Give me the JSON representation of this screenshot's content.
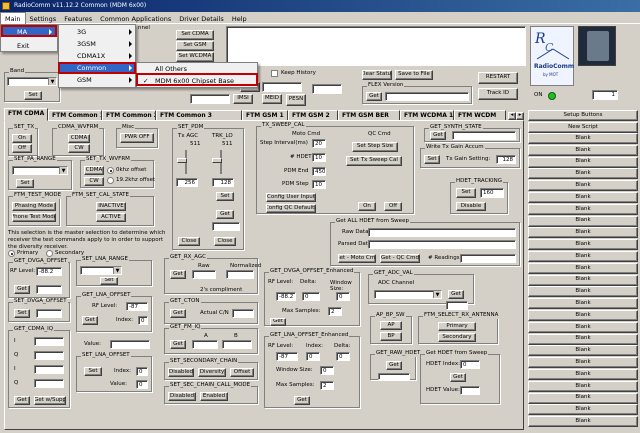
{
  "title": "RadioComm  v11.12.2  Common (MDM 6x00)",
  "menu": [
    "Main",
    "Settings",
    "Features",
    "Common Applications",
    "Driver Details",
    "Help"
  ],
  "main_menu": {
    "ma": "MA",
    "exit": "Exit"
  },
  "ma_submenu": [
    "3G",
    "3GSM",
    "CDMA1X",
    "Common",
    "GSM"
  ],
  "common_submenu": {
    "all_others": "All Others",
    "mdm": "MDM 6x00 Chipset Base"
  },
  "top": {
    "set_cdma": "Set CDMA",
    "set_gsm": "Set GSM",
    "set_wcdma": "Set WCDMA",
    "channel": "nnel",
    "band": "Band",
    "set": "Set",
    "keep_history": "Keep History",
    "clear_status": "Clear Status",
    "save_to_file": "Save to File",
    "esn": "ESN",
    "imsi": "IMSI",
    "meid": "MEID",
    "pesn": "PESN",
    "get": "Get",
    "flex_version": "FLEX Version",
    "restart": "RESTART",
    "track_id": "Track ID",
    "logo_text": "RadioComm",
    "logo_by": "by MOT",
    "on": "ON",
    "spin_val": "1"
  },
  "tabs": [
    "FTM CDMA",
    "FTM Common 1",
    "FTM Common 2",
    "FTM Common 3",
    "FTM GSM 1",
    "FTM GSM 2",
    "FTM GSM BER",
    "FTM WCDMA 1",
    "FTM WCDM"
  ],
  "right": {
    "setup_buttons": "Setup Buttons",
    "new_script": "New Script",
    "blank": "Blank"
  },
  "cdma": {
    "set_tx": "SET_TX",
    "on": "On",
    "off": "Off",
    "cdma_wvfrm": "CDMA_WVFRM",
    "cdma": "CDMA",
    "cw": "CW",
    "misc": "Misc",
    "pwr_off": "PWR OFF",
    "set_pdm": "SET_PDM",
    "tx_agc": "Tx AGC",
    "trk_lo": "TRK_LO",
    "agc_val": "511",
    "trk_val": "511",
    "agc_spin": "256",
    "trk_spin": "128",
    "set": "Set",
    "get": "Get",
    "close": "Close",
    "tx_sweep": "TX_SWEEP_CAL",
    "moto_cmd": "Moto Cmd",
    "qc_cmd": "QC Cmd",
    "step_interval": "Step Interval(ms)",
    "step_interval_val": "20",
    "hdet": "# HDET",
    "hdet_val": "10",
    "pdm_end": "PDM End",
    "pdm_end_val": "450",
    "pdm_step": "PDM Step",
    "pdm_step_val": "10",
    "set_step_size": "Set Step Size",
    "set_tx_sweep_cal": "Set Tx Sweep Cal",
    "config_user_input": "Config User Input",
    "config_qc_defaults": "Config QC Defaults",
    "get_synth": "GET_SYNTH_STATE",
    "write_tx_gain": "Write Tx Gain Accum",
    "tx_gain_setting": "Tx Gain Setting:",
    "tx_gain_val": "128",
    "hdet_tracking": "HDET_TRACKING",
    "hdet_set_val": "160",
    "disable": "Disable",
    "set_pa_range": "SET_PA_RANGE",
    "set_tx_wvfrm": "SET_TX_WVFRM",
    "khz0": "0khz offset",
    "khz192": "19.2khz offset",
    "ftm_test_mode": "FTM_TEST_MODE",
    "phasing_mode": "Phasing Mode",
    "phone_test_mode": "Phone Test Mode",
    "ftm_set_cal_state": "FTM_SET_CAL_STATE",
    "inactive": "INACTIVE",
    "active": "ACTIVE",
    "get_all_hdet": "Get ALL HDET from Sweep",
    "raw_data": "Raw Data:",
    "parsed_data": "Parsed Data:",
    "get_moto_cmd": "Get - Moto Cmd",
    "get_qc_cmd": "Get - QC Cmd",
    "readings": "# Readings:",
    "selection_text": "This selection is the master selection to determine which receiver the test commands apply to in order to support the diversity receiver.",
    "primary": "Primary",
    "secondary": "Secondary",
    "get_dvga": "GET_DVGA_OFFSET",
    "rf_level": "RF Level:",
    "rf_level_val": "-88.2",
    "set_dvga": "SET_DVGA_OFFSET",
    "set_lna_range": "SET_LNA_RANGE",
    "get_lna_offset": "GET_LNA_OFFSET",
    "lna_rf_val": "-87",
    "index": "Index:",
    "index_val": "0",
    "value": "Value:",
    "set_lna_offset": "SET_LNA_OFFSET",
    "value_val": "0",
    "get_rx_agc": "GET_RX_AGC",
    "raw": "Raw",
    "normalized": "Normalized",
    "twos": "2's compliment",
    "get_ctcn": "GET_CTON",
    "actual_cn": "Actual C/N",
    "get_fm_iq": "GET_FM_IQ",
    "a": "A",
    "b": "B",
    "set_secondary_chain": "SET_SECONDARY_CHAIN",
    "disabled": "Disabled",
    "diversity": "Diversity",
    "offset": "Offset",
    "set_sec_call": "SET_SEC_CHAIN_CALL_MODE",
    "enabled": "Enabled",
    "get_dvga_enh": "GET_DVGA_OFFSET_Enhanced",
    "delta": "Delta:",
    "window_size": "Window Size:",
    "dvga_enh_val": "-88.2",
    "dvga_delta": "0",
    "dvga_win": "0",
    "max_samples": "Max Samples:",
    "max_samples_val": "2",
    "get_lna_enh": "GET_LNA_OFFSET_Enhanced",
    "lna_enh_val": "-87",
    "lna_enh_idx": "0",
    "lna_enh_delta": "0",
    "lna_win_val": "0",
    "lna_max_val": "2",
    "get_adc_val": "GET_ADC_VAL",
    "adc_channel": "ADC Channel",
    "ap_bp_sw": "AP_BP_SW",
    "ap": "AP",
    "bp": "BP",
    "ftm_select_rx": "FTM_SELECT_RX_ANTENNA",
    "primary_btn": "Primary",
    "secondary_btn": "Secondary",
    "get_raw_hdet": "GET_RAW_HDET",
    "get_hdet_sweep": "Get HDET from Sweep",
    "hdet_index": "HDET Index:",
    "hdet_index_val": "0",
    "hdet_value": "HDET Value:",
    "get_cdma_iq": "GET_CDMA_IQ",
    "i": "I",
    "q": "Q",
    "get_w_supp": "Get w/Supp"
  }
}
